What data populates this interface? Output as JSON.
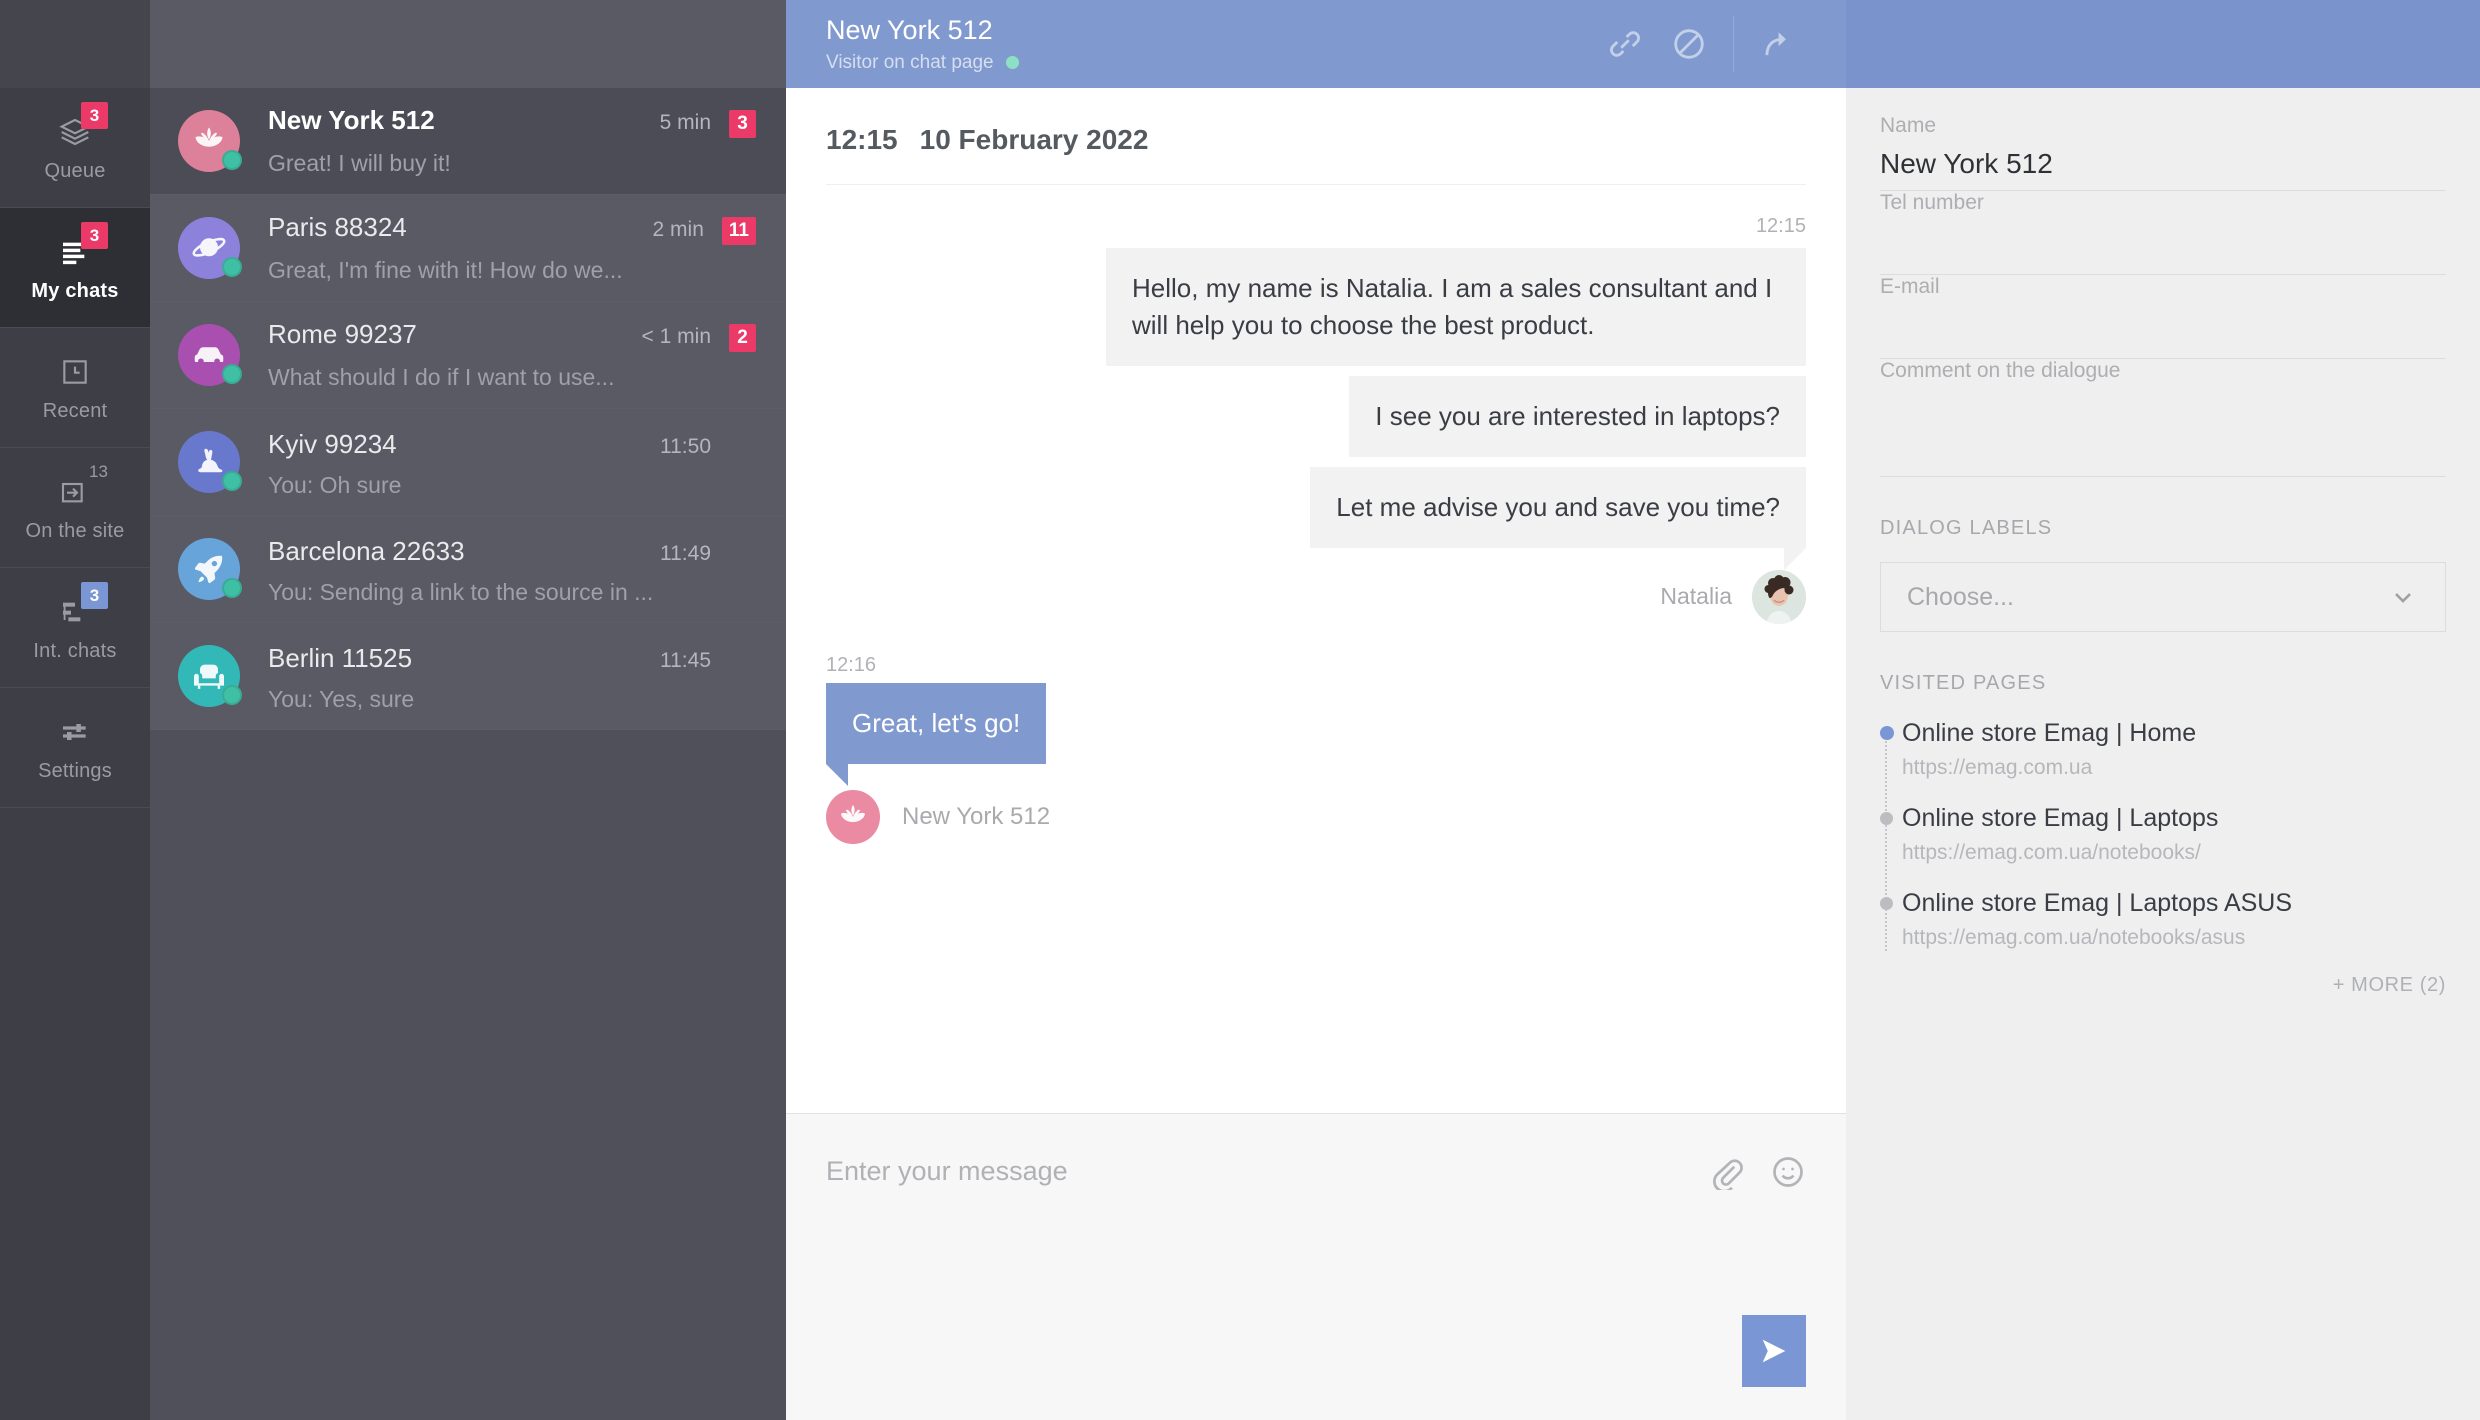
{
  "sidebar": {
    "items": [
      {
        "label": "Queue",
        "icon": "layers-icon",
        "badge": "3",
        "badge_style": "pink",
        "active": false
      },
      {
        "label": "My chats",
        "icon": "chat-lines-icon",
        "badge": "3",
        "badge_style": "pink",
        "active": true
      },
      {
        "label": "Recent",
        "icon": "clock-icon",
        "badge": "",
        "badge_style": "none",
        "active": false
      },
      {
        "label": "On the site",
        "icon": "enter-arrow-icon",
        "badge": "13",
        "badge_style": "plain",
        "active": false
      },
      {
        "label": "Int. chats",
        "icon": "internal-chat-icon",
        "badge": "3",
        "badge_style": "blue",
        "active": false
      },
      {
        "label": "Settings",
        "icon": "sliders-icon",
        "badge": "",
        "badge_style": "none",
        "active": false
      }
    ]
  },
  "chat_list": [
    {
      "name": "New York 512",
      "preview": "Great! I will buy it!",
      "time": "5 min",
      "count": "3",
      "icon": "lotus-icon",
      "color": "#dd8099",
      "active": true,
      "online": true
    },
    {
      "name": "Paris 88324",
      "preview": "Great, I'm fine with it! How do we...",
      "time": "2 min",
      "count": "11",
      "icon": "planet-icon",
      "color": "#8d82db",
      "active": false,
      "online": true
    },
    {
      "name": "Rome 99237",
      "preview": "What should I do if I want to use...",
      "time": "< 1 min",
      "count": "2",
      "icon": "car-icon",
      "color": "#a84fb0",
      "active": false,
      "online": true
    },
    {
      "name": "Kyiv 99234",
      "preview": "You: Oh sure",
      "time": "11:50",
      "count": "",
      "icon": "rabbit-icon",
      "color": "#6878cd",
      "active": false,
      "online": true
    },
    {
      "name": "Barcelona 22633",
      "preview": "You: Sending a link to the source in ...",
      "time": "11:49",
      "count": "",
      "icon": "rocket-icon",
      "color": "#66a4da",
      "active": false,
      "online": true
    },
    {
      "name": "Berlin 11525",
      "preview": "You: Yes, sure",
      "time": "11:45",
      "count": "",
      "icon": "armchair-icon",
      "color": "#33b8b8",
      "active": false,
      "online": true
    }
  ],
  "conversation": {
    "title": "New York 512",
    "subtitle": "Visitor on chat page",
    "actions": [
      {
        "name": "attach-link-icon",
        "title": "link"
      },
      {
        "name": "ban-icon",
        "title": "ban"
      },
      {
        "name": "forward-icon",
        "title": "forward"
      }
    ],
    "day_time": "12:15",
    "day_date": "10 February 2022",
    "agent_group": {
      "stamp": "12:15",
      "messages": [
        "Hello, my name is Natalia. I am a sales consultant and I will help you to choose the best product.",
        "I see you are interested in laptops?",
        "Let me advise you and save you time?"
      ],
      "sender": "Natalia"
    },
    "visitor_group": {
      "stamp": "12:16",
      "messages": [
        "Great, let's go!"
      ],
      "sender": "New York 512"
    },
    "composer": {
      "placeholder": "Enter your message",
      "value": "",
      "attach_icon": "paperclip-icon",
      "emoji_icon": "smiley-icon",
      "send_icon": "send-icon"
    }
  },
  "side_panel": {
    "fields": [
      {
        "label": "Name",
        "value": "New York 512",
        "filled": true
      },
      {
        "label": "Tel number",
        "value": "",
        "filled": false
      },
      {
        "label": "E-mail",
        "value": "",
        "filled": false
      },
      {
        "label": "Comment on the dialogue",
        "value": "",
        "filled": false
      }
    ],
    "dialog_labels_title": "DIALOG LABELS",
    "dialog_labels_select": "Choose...",
    "visited_pages_title": "VISITED PAGES",
    "visited_pages": [
      {
        "title": "Online store Emag | Home",
        "url": "https://emag.com.ua",
        "current": true
      },
      {
        "title": "Online store Emag | Laptops",
        "url": "https://emag.com.ua/notebooks/",
        "current": false
      },
      {
        "title": "Online store Emag | Laptops ASUS",
        "url": "https://emag.com.ua/notebooks/asus",
        "current": false
      }
    ],
    "more_label": "+ MORE (2)"
  },
  "colors": {
    "accent_blue": "#8099cf",
    "panel_blue": "#7b93cd",
    "badge_pink": "#ec3a68",
    "badge_blue": "#7b96d4",
    "online_green": "#3fc0a5",
    "rail_bg": "#3d3e46",
    "list_bg": "#595a64"
  }
}
